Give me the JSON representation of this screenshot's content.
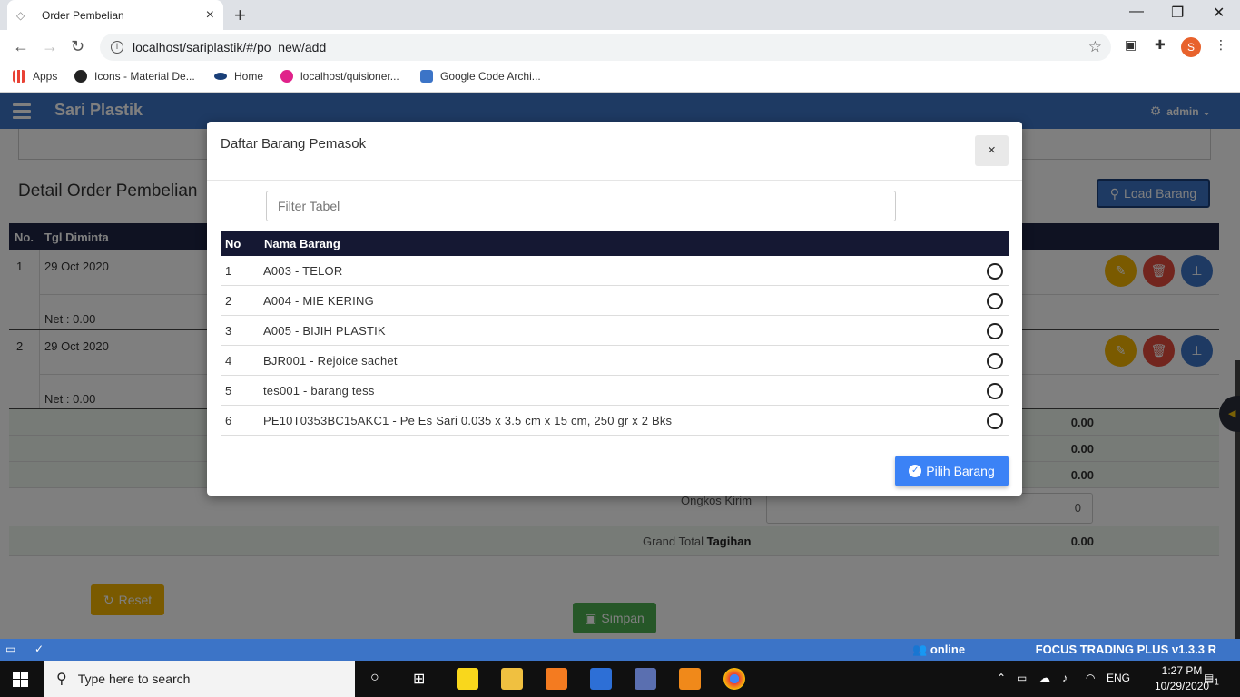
{
  "browser": {
    "tab_title": "Order Pembelian",
    "tab_close": "×",
    "new_tab": "+",
    "url": "localhost/sariplastik/#/po_new/add",
    "profile_letter": "S",
    "bookmarks": [
      "Apps",
      "Icons - Material De...",
      "Home",
      "localhost/quisioner...",
      "Google Code Archi..."
    ]
  },
  "app": {
    "brand": "Sari Plastik",
    "user": "admin",
    "section_title": "Detail Order Pembelian",
    "load_button": "Load Barang",
    "table_headers": {
      "no": "No.",
      "tgl": "Tgl Diminta"
    },
    "rows": [
      {
        "no": "1",
        "date": "29 Oct 2020",
        "net": "Net : 0.00"
      },
      {
        "no": "2",
        "date": "29 Oct 2020",
        "net": "Net : 0.00"
      }
    ],
    "summary_values": [
      "0.00",
      "0.00",
      "0.00"
    ],
    "ongkos_label": "Ongkos Kirim",
    "ongkos_value": "0",
    "grand_total_label": "Grand Total",
    "grand_total_label_bold": "Tagihan",
    "grand_total_value": "0.00",
    "reset_button": "Reset",
    "save_button": "Simpan"
  },
  "footer": {
    "status": "online",
    "version": "FOCUS TRADING PLUS v1.3.3 R"
  },
  "modal": {
    "title": "Daftar Barang Pemasok",
    "close": "×",
    "filter_placeholder": "Filter Tabel",
    "headers": {
      "no": "No",
      "name": "Nama Barang"
    },
    "items": [
      {
        "no": "1",
        "name": "A003 - TELOR"
      },
      {
        "no": "2",
        "name": "A004 - MIE KERING"
      },
      {
        "no": "3",
        "name": "A005 - BIJIH PLASTIK"
      },
      {
        "no": "4",
        "name": "BJR001 - Rejoice sachet"
      },
      {
        "no": "5",
        "name": "tes001 - barang tess"
      },
      {
        "no": "6",
        "name": "PE10T0353BC15AKC1 - Pe Es Sari 0.035 x 3.5 cm x 15 cm, 250 gr x 2 Bks"
      }
    ],
    "select_button": "Pilih Barang"
  },
  "taskbar": {
    "search_text": "Type here to search",
    "language": "ENG",
    "time": "1:27 PM",
    "date": "10/29/2020",
    "notification_count": "1"
  },
  "colors": {
    "primary": "#3c74c7",
    "dark_header": "#151833",
    "modal_button": "#3b82f6"
  }
}
